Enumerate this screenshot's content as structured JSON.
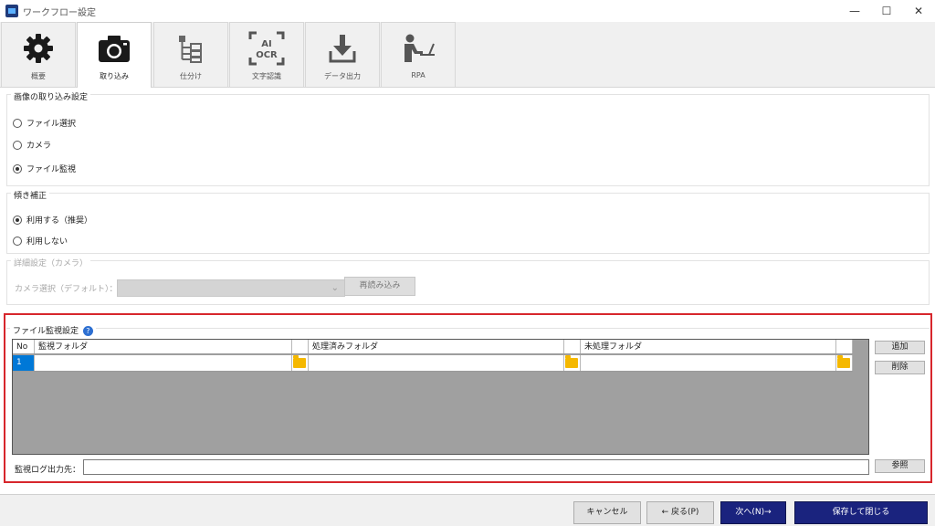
{
  "window": {
    "title": "ワークフロー設定",
    "minimize_glyph": "—",
    "maximize_glyph": "☐",
    "close_glyph": "✕"
  },
  "tabs": [
    {
      "label": "概要",
      "icon": "gear-icon"
    },
    {
      "label": "取り込み",
      "icon": "camera-icon"
    },
    {
      "label": "仕分け",
      "icon": "sort-tree-icon"
    },
    {
      "label": "文字認識",
      "icon": "ai-ocr-icon"
    },
    {
      "label": "データ出力",
      "icon": "download-icon"
    },
    {
      "label": "RPA",
      "icon": "person-computer-icon"
    }
  ],
  "active_tab": "取り込み",
  "ai_ocr_icon": {
    "line1": "AI",
    "line2": "OCR"
  },
  "image_import": {
    "title": "画像の取り込み設定",
    "options": [
      "ファイル選択",
      "カメラ",
      "ファイル監視"
    ],
    "selected": "ファイル監視"
  },
  "skew_correction": {
    "title": "傾き補正",
    "options": [
      "利用する（推奨）",
      "利用しない"
    ],
    "selected": "利用する（推奨）"
  },
  "camera_detail": {
    "title": "詳細設定（カメラ）",
    "camera_label": "カメラ選択（デフォルト）：",
    "camera_value": "",
    "reload_button": "再読み込み"
  },
  "file_watch": {
    "title": "ファイル監視設定",
    "help_glyph": "?",
    "columns": {
      "no": "No",
      "watch": "監視フォルダ",
      "processed": "処理済みフォルダ",
      "unprocessed": "未処理フォルダ"
    },
    "rows": [
      {
        "no": "1",
        "watch": "",
        "processed": "",
        "unprocessed": ""
      }
    ],
    "add_button": "追加",
    "delete_button": "削除",
    "log_label": "監視ログ出力先：",
    "log_value": "",
    "browse_button": "参照"
  },
  "footer": {
    "cancel": "キャンセル",
    "back": "← 戻る(P)",
    "next": "次へ(N)→",
    "save_close": "保存して閉じる"
  },
  "colors": {
    "highlight_border": "#d7262c",
    "navy_button": "#1a237e",
    "selected_row_cell": "#0078d7",
    "folder": "#f5b800",
    "grid_background": "#a0a0a0"
  }
}
